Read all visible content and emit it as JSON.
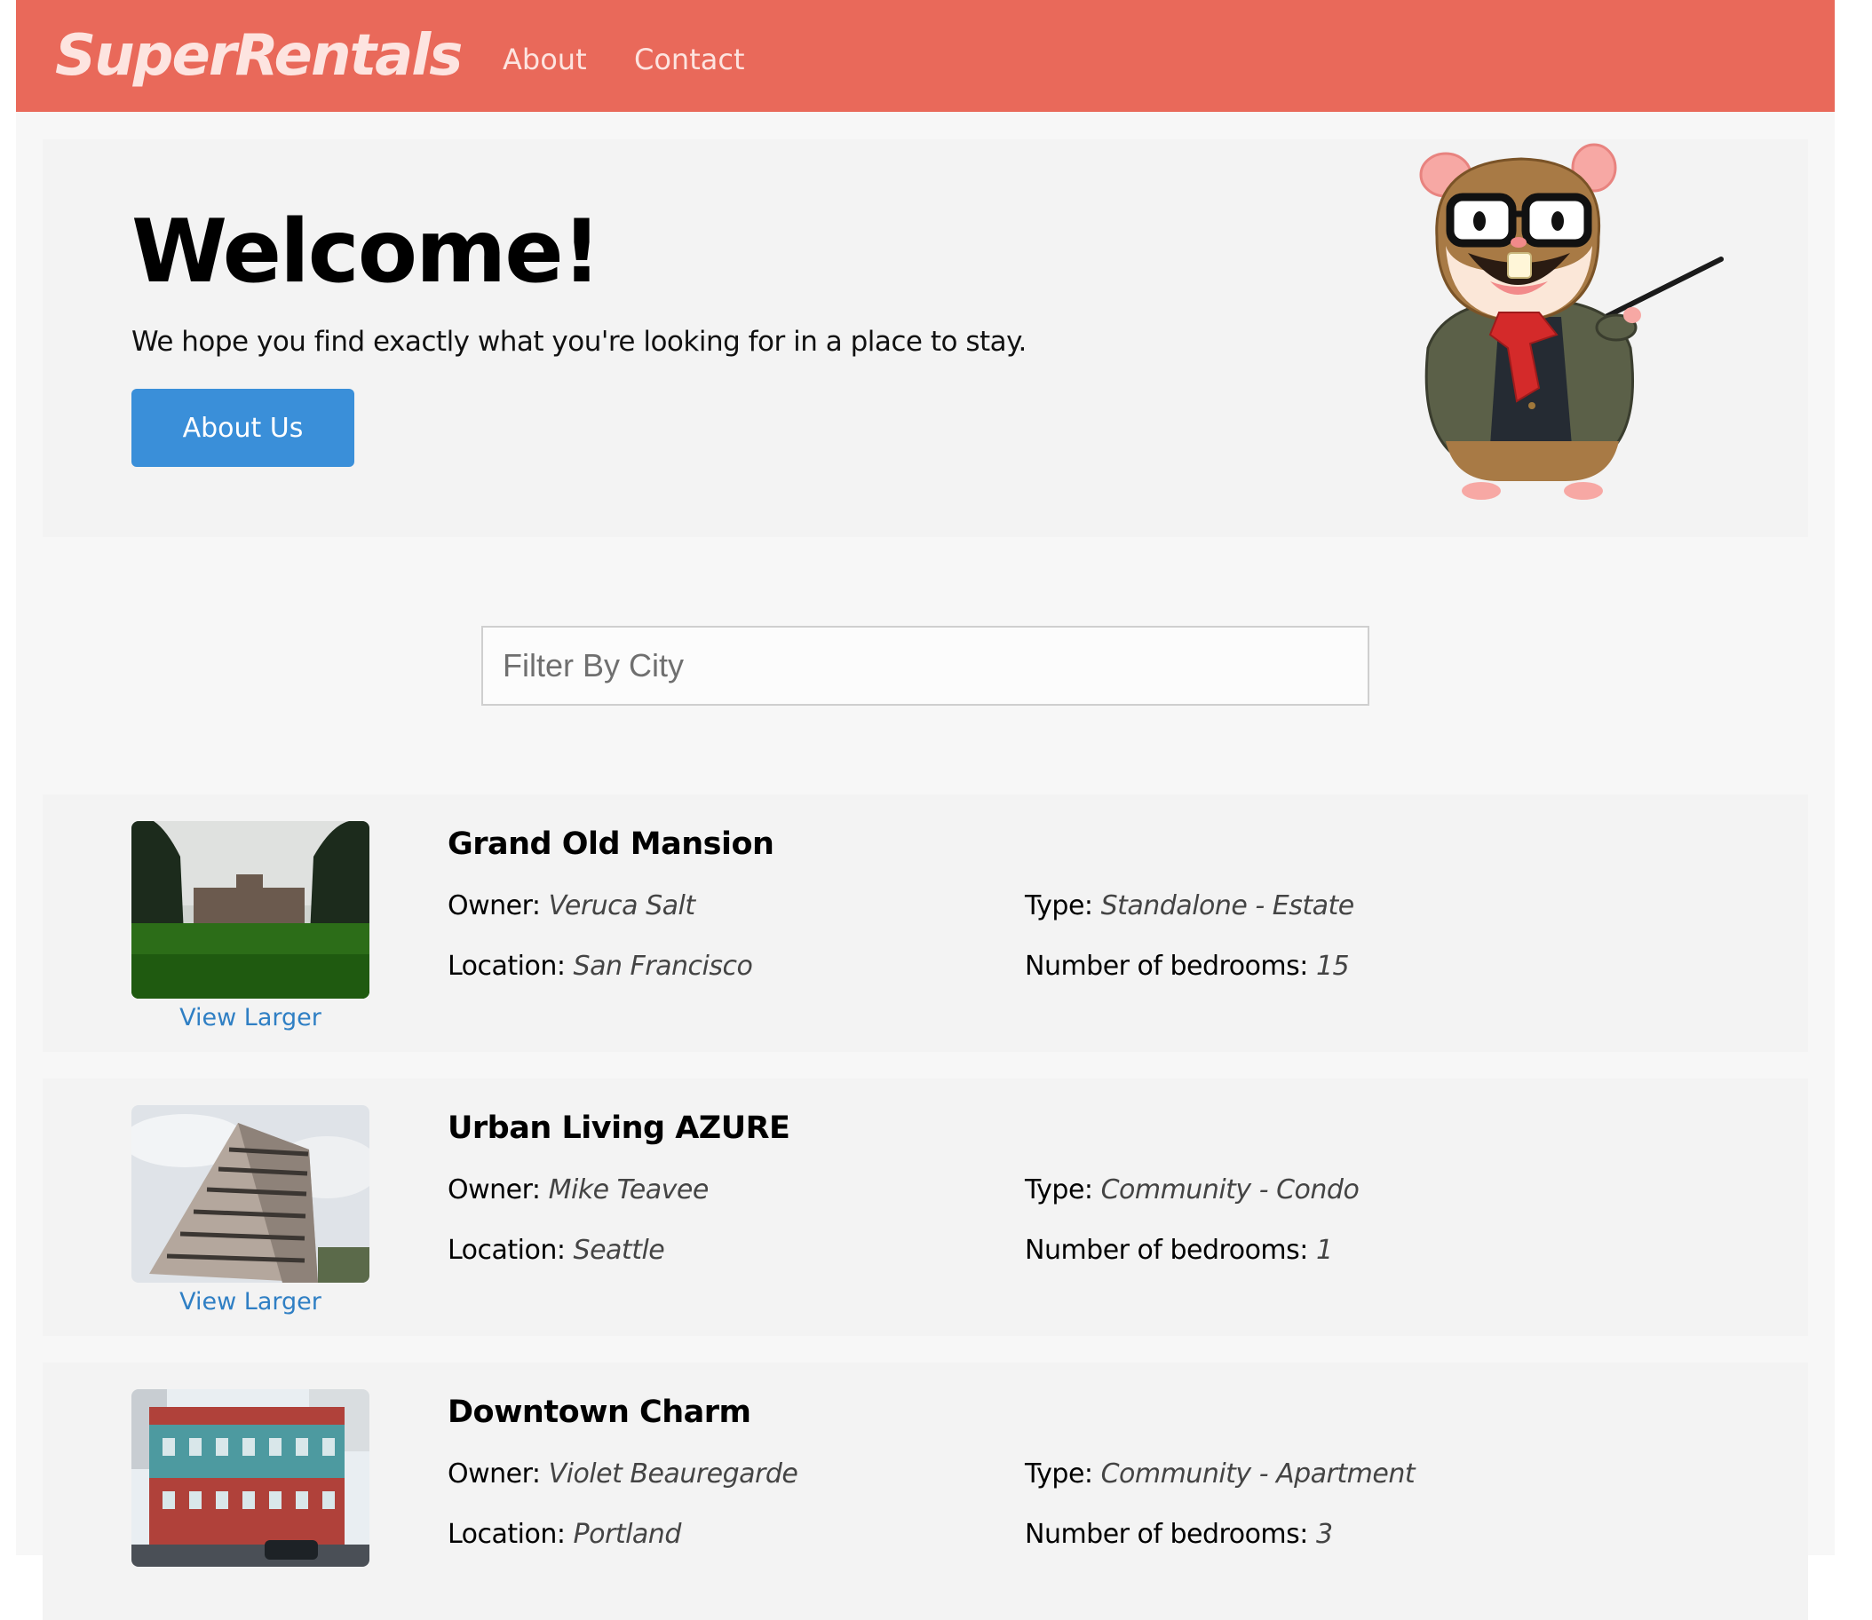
{
  "header": {
    "brand": "SuperRentals",
    "nav": [
      {
        "label": "About"
      },
      {
        "label": "Contact"
      }
    ],
    "accent_color": "#e9695a"
  },
  "jumbo": {
    "title": "Welcome!",
    "tagline": "We hope you find exactly what you're looking for in a place to stay.",
    "button_label": "About Us",
    "button_color": "#3a8fd9",
    "mascot_icon": "tomster-hamster-icon"
  },
  "filter": {
    "placeholder": "Filter By City",
    "value": ""
  },
  "labels": {
    "owner": "Owner:",
    "type": "Type:",
    "location": "Location:",
    "bedrooms": "Number of bedrooms:",
    "view_larger": "View Larger"
  },
  "rentals": [
    {
      "title": "Grand Old Mansion",
      "owner": "Veruca Salt",
      "type": "Standalone - Estate",
      "location": "San Francisco",
      "bedrooms": "15"
    },
    {
      "title": "Urban Living AZURE",
      "owner": "Mike Teavee",
      "type": "Community - Condo",
      "location": "Seattle",
      "bedrooms": "1"
    },
    {
      "title": "Downtown Charm",
      "owner": "Violet Beauregarde",
      "type": "Community - Apartment",
      "location": "Portland",
      "bedrooms": "3"
    }
  ]
}
